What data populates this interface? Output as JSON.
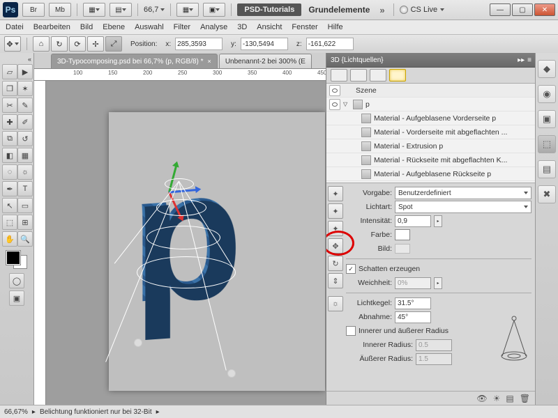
{
  "titlebar": {
    "br": "Br",
    "mb": "Mb",
    "zoom": "66,7",
    "psd_tutorials": "PSD-Tutorials",
    "workspace": "Grundelemente",
    "cslive": "CS Live"
  },
  "menu": [
    "Datei",
    "Bearbeiten",
    "Bild",
    "Ebene",
    "Auswahl",
    "Filter",
    "Analyse",
    "3D",
    "Ansicht",
    "Fenster",
    "Hilfe"
  ],
  "optionbar": {
    "position_label": "Position:",
    "x_label": "x:",
    "x": "285,3593",
    "y_label": "y:",
    "y": "-130,5494",
    "z_label": "z:",
    "z": "-161,622"
  },
  "tabs": {
    "active": "3D-Typocomposing.psd bei 66,7% (p, RGB/8) *",
    "other": "Unbenannt-2 bei 300% (E"
  },
  "ruler_ticks": [
    "100",
    "150",
    "200",
    "250",
    "300",
    "350",
    "400",
    "450"
  ],
  "canvas": {
    "letter": "p"
  },
  "panel": {
    "title": "3D {Lichtquellen}",
    "tree": {
      "root": "Szene",
      "group": "p",
      "materials": [
        "Material - Aufgeblasene Vorderseite p",
        "Material - Vorderseite mit abgeflachten ...",
        "Material - Extrusion p",
        "Material - Rückseite mit abgeflachten K...",
        "Material - Aufgeblasene Rückseite p"
      ]
    },
    "props": {
      "vorgabe_label": "Vorgabe:",
      "vorgabe_value": "Benutzerdefiniert",
      "lichtart_label": "Lichtart:",
      "lichtart_value": "Spot",
      "intensitat_label": "Intensität:",
      "intensitat_value": "0,9",
      "farbe_label": "Farbe:",
      "bild_label": "Bild:",
      "schatten_label": "Schatten erzeugen",
      "weichheit_label": "Weichheit:",
      "weichheit_value": "0%",
      "lichtkegel_label": "Lichtkegel:",
      "lichtkegel_value": "31.5°",
      "abnahme_label": "Abnahme:",
      "abnahme_value": "45°",
      "inner_outer_label": "Innerer und äußerer Radius",
      "inner_label": "Innerer Radius:",
      "inner_value": "0.5",
      "outer_label": "Äußerer Radius:",
      "outer_value": "1.5"
    }
  },
  "statusbar": {
    "zoom": "66,67%",
    "msg": "Belichtung funktioniert nur bei 32-Bit"
  }
}
